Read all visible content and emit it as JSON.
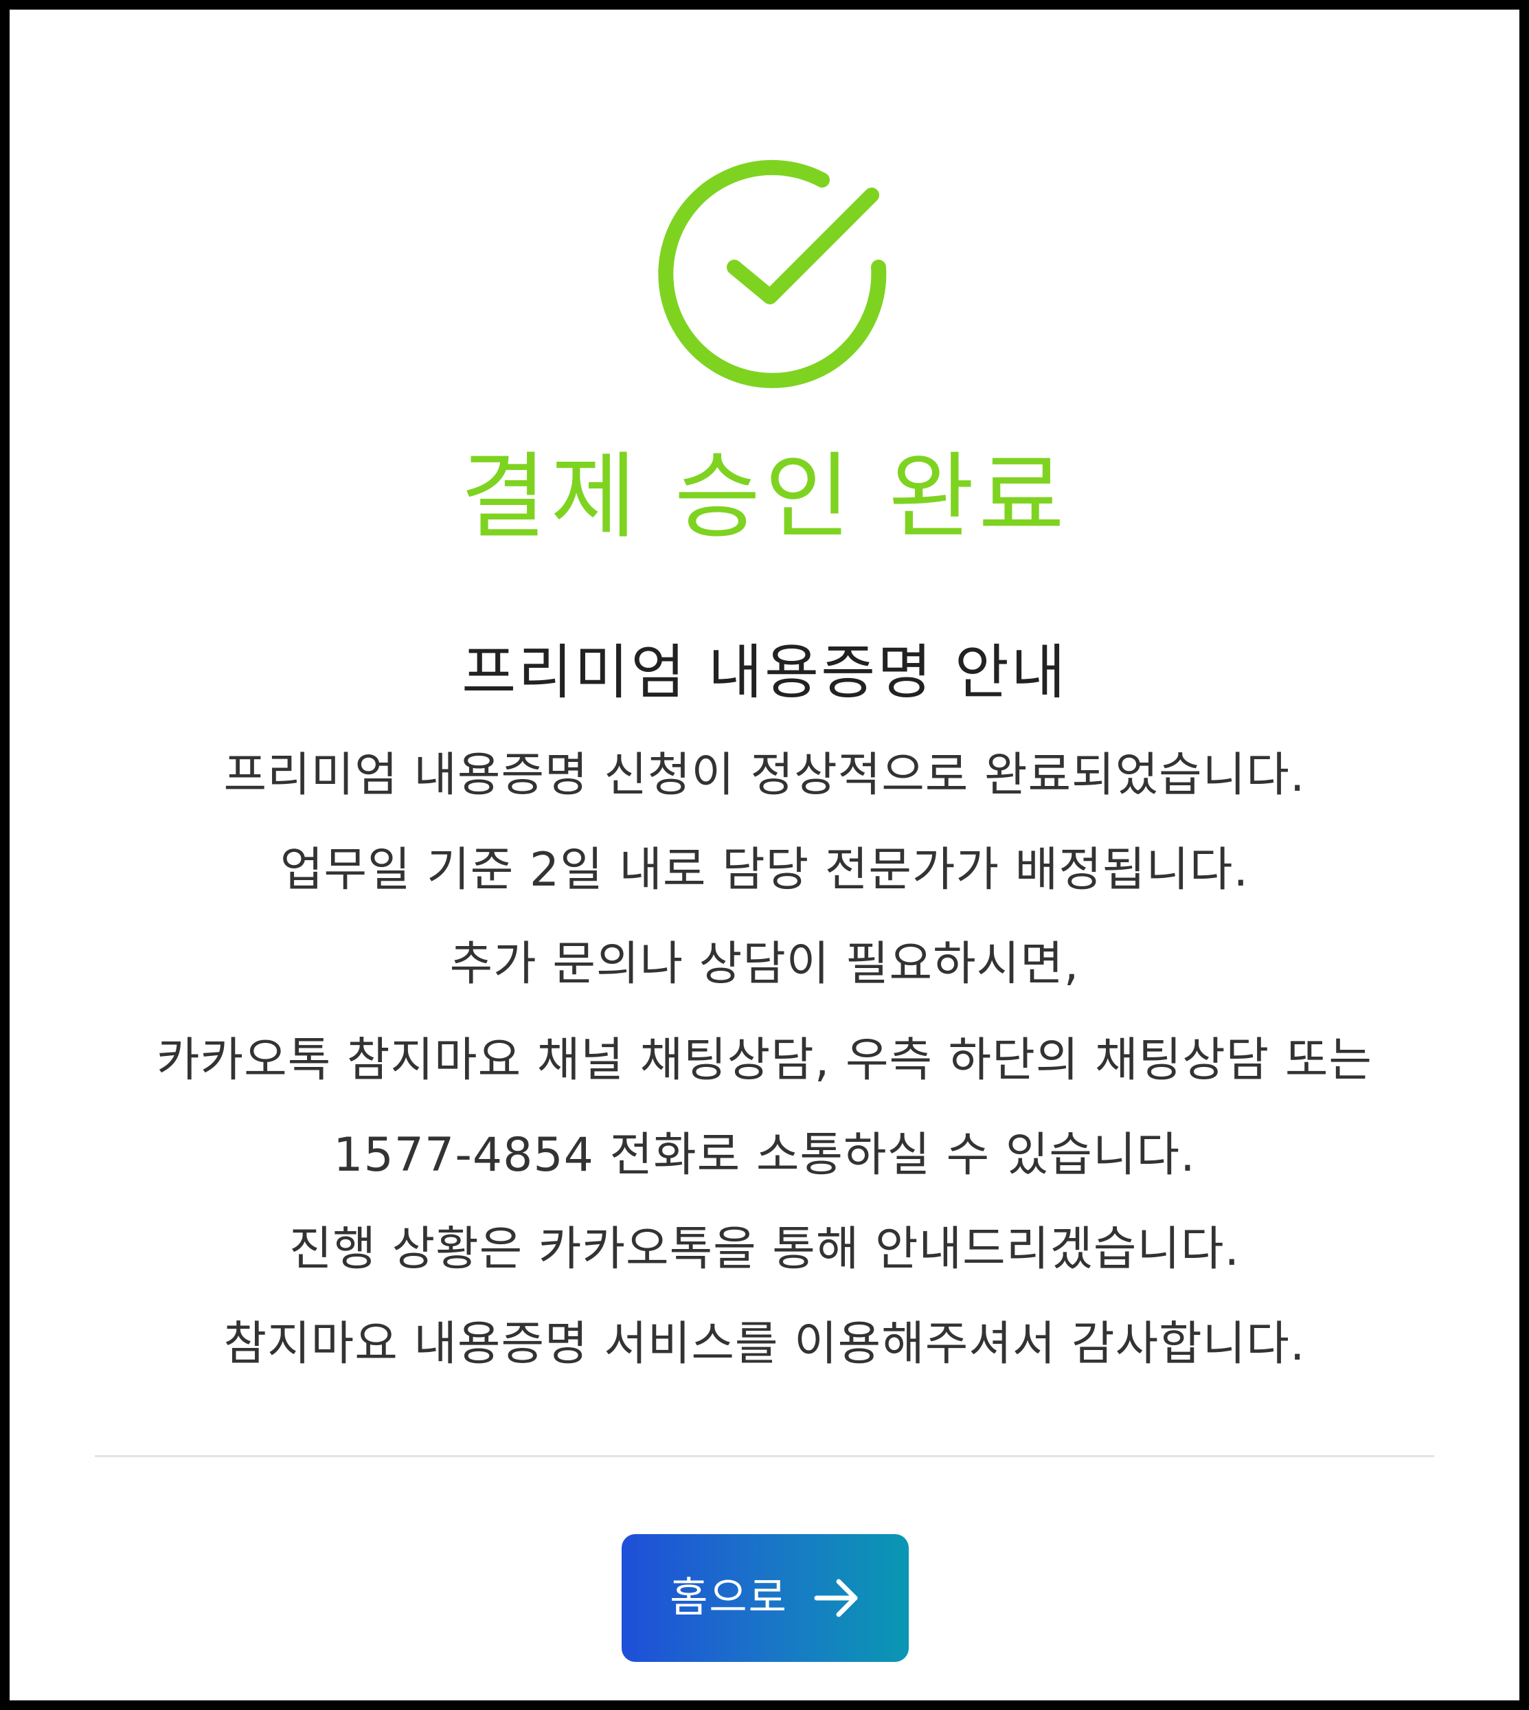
{
  "icon": {
    "name": "check-circle-icon",
    "color": "#7ed321"
  },
  "title": "결제 승인 완료",
  "subtitle": "프리미엄 내용증명 안내",
  "message_lines": [
    "프리미엄 내용증명 신청이 정상적으로 완료되었습니다.",
    "업무일 기준 2일 내로 담당 전문가가 배정됩니다.",
    "추가 문의나 상담이 필요하시면,",
    "카카오톡 참지마요 채널 채팅상담, 우측 하단의 채팅상담 또는",
    "1577-4854 전화로 소통하실 수 있습니다.",
    "진행 상황은 카카오톡을 통해 안내드리겠습니다.",
    "참지마요 내용증명 서비스를 이용해주셔서 감사합니다."
  ],
  "home_button": {
    "label": "홈으로",
    "icon": "arrow-right-icon",
    "gradient": [
      "#1f4fd8",
      "#0a97b3"
    ]
  },
  "colors": {
    "accent": "#7ed321",
    "text": "#333333",
    "divider": "#e3e3e3"
  }
}
